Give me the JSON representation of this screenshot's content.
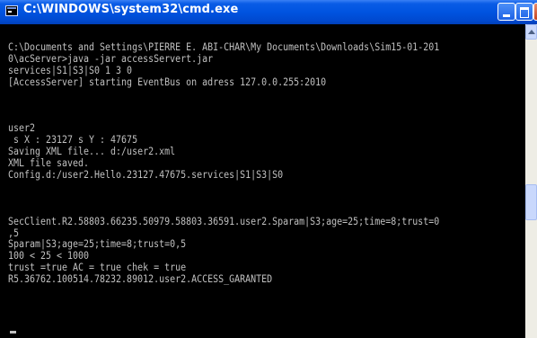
{
  "window": {
    "title": "C:\\WINDOWS\\system32\\cmd.exe"
  },
  "console": {
    "lines": [
      "C:\\Documents and Settings\\PIERRE E. ABI-CHAR\\My Documents\\Downloads\\Sim15-01-201",
      "0\\acServer>java -jar accessServert.jar",
      "services|S1|S3|S0 1 3 0",
      "[AccessServer] starting EventBus on adress 127.0.0.255:2010",
      "",
      "",
      "",
      "user2",
      " s X : 23127 s Y : 47675",
      "Saving XML file... d:/user2.xml",
      "XML file saved.",
      "Config.d:/user2.Hello.23127.47675.services|S1|S3|S0",
      "",
      "",
      "",
      "SecClient.R2.58803.66235.50979.58803.36591.user2.Sparam|S3;age=25;time=8;trust=0",
      ",5",
      "Sparam|S3;age=25;time=8;trust=0,5",
      "100 < 25 < 1000",
      "trust =true AC = true chek = true",
      "R5.36762.100514.78232.89012.user2.ACCESS_GARANTED"
    ]
  },
  "colors": {
    "titlebar": "#0053e0",
    "console_bg": "#000000",
    "console_text": "#c0c0c0"
  },
  "icons": {
    "window": "console-app-icon",
    "minimize": "minimize-icon",
    "maximize": "maximize-icon",
    "close": "close-icon",
    "scroll_up": "arrow-up-icon"
  }
}
